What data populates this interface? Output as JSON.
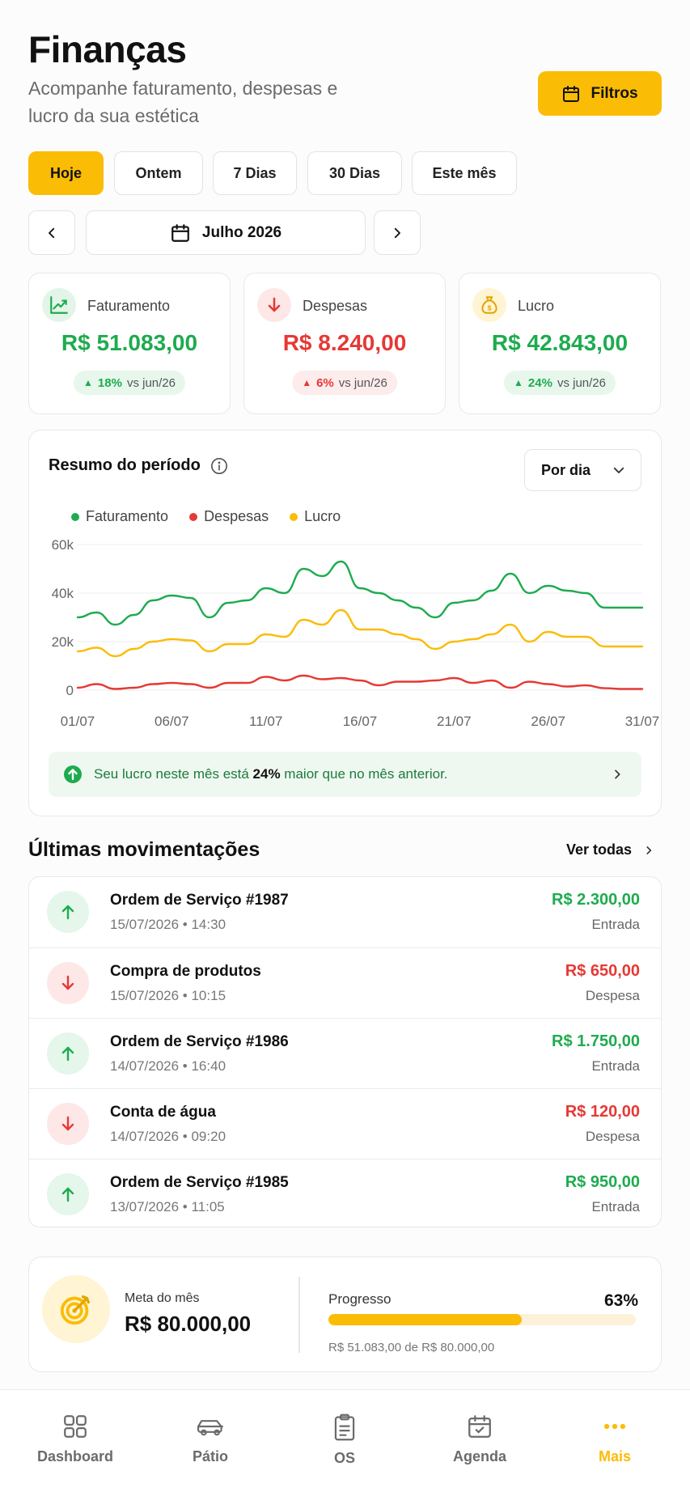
{
  "header": {
    "title": "Finanças",
    "subtitle": "Acompanhe faturamento, despesas e lucro da sua estética",
    "filters_label": "Filtros"
  },
  "periods": [
    "Hoje",
    "Ontem",
    "7 Dias",
    "30 Dias",
    "Este mês"
  ],
  "active_period": "Hoje",
  "month_nav": {
    "label": "Julho 2026"
  },
  "kpis": [
    {
      "label": "Faturamento",
      "value": "R$ 51.083,00",
      "change": "18%",
      "compare": "vs jun/26",
      "color": "#1eab4f"
    },
    {
      "label": "Despesas",
      "value": "R$ 8.240,00",
      "change": "6%",
      "compare": "vs jun/26",
      "color": "#e53935"
    },
    {
      "label": "Lucro",
      "value": "R$ 42.843,00",
      "change": "24%",
      "compare": "vs jun/26",
      "color": "#1eab4f"
    }
  ],
  "summary": {
    "title": "Resumo do período",
    "granularity": "Por dia",
    "insight_prefix": "Seu lucro neste mês está ",
    "insight_bold": "24%",
    "insight_suffix": " maior que no mês anterior."
  },
  "chart_data": {
    "type": "line",
    "x_tick_labels": [
      "01/07",
      "06/07",
      "11/07",
      "16/07",
      "21/07",
      "26/07",
      "31/07"
    ],
    "y_tick_labels": [
      "60k",
      "40k",
      "20k",
      "0"
    ],
    "ylim": [
      0,
      60000
    ],
    "x": [
      "01/07",
      "02/07",
      "03/07",
      "04/07",
      "05/07",
      "06/07",
      "07/07",
      "08/07",
      "09/07",
      "10/07",
      "11/07",
      "12/07",
      "13/07",
      "14/07",
      "15/07",
      "16/07",
      "17/07",
      "18/07",
      "19/07",
      "20/07",
      "21/07",
      "22/07",
      "23/07",
      "24/07",
      "25/07",
      "26/07",
      "27/07",
      "28/07",
      "29/07",
      "30/07",
      "31/07"
    ],
    "series": [
      {
        "name": "Faturamento",
        "color": "#1eab4f",
        "values": [
          30000,
          32000,
          27000,
          31000,
          37000,
          39000,
          38000,
          30000,
          36000,
          37000,
          42000,
          40000,
          50000,
          47000,
          53000,
          42000,
          40000,
          37000,
          34000,
          30000,
          36000,
          37000,
          41000,
          48000,
          40000,
          43000,
          41000,
          40000,
          34000,
          34000,
          34000
        ]
      },
      {
        "name": "Despesas",
        "color": "#e53935",
        "values": [
          1000,
          2500,
          500,
          1000,
          2500,
          3000,
          2500,
          1000,
          3000,
          3000,
          5500,
          4000,
          6000,
          4500,
          5000,
          4000,
          2000,
          3500,
          3500,
          4000,
          5000,
          3000,
          4000,
          1000,
          3500,
          2500,
          1500,
          2000,
          800,
          500,
          500
        ]
      },
      {
        "name": "Lucro",
        "color": "#fbbc05",
        "values": [
          16000,
          17500,
          14000,
          17000,
          20000,
          21000,
          20500,
          16000,
          19000,
          19000,
          23000,
          22000,
          29000,
          27000,
          33000,
          25000,
          25000,
          23000,
          21000,
          17000,
          20000,
          21000,
          23000,
          27000,
          20000,
          24000,
          22000,
          22000,
          18000,
          18000,
          18000
        ]
      }
    ],
    "legend": "top-left",
    "grid": true
  },
  "movements": {
    "title": "Últimas movimentações",
    "see_all": "Ver todas",
    "items": [
      {
        "name": "Ordem de Serviço #1987",
        "date": "15/07/2026 • 14:30",
        "amount": "R$ 2.300,00",
        "kind": "Entrada",
        "type": "in"
      },
      {
        "name": "Compra de produtos",
        "date": "15/07/2026 • 10:15",
        "amount": "R$ 650,00",
        "kind": "Despesa",
        "type": "out"
      },
      {
        "name": "Ordem de Serviço #1986",
        "date": "14/07/2026 • 16:40",
        "amount": "R$ 1.750,00",
        "kind": "Entrada",
        "type": "in"
      },
      {
        "name": "Conta de água",
        "date": "14/07/2026 • 09:20",
        "amount": "R$ 120,00",
        "kind": "Despesa",
        "type": "out"
      },
      {
        "name": "Ordem de Serviço #1985",
        "date": "13/07/2026 • 11:05",
        "amount": "R$ 950,00",
        "kind": "Entrada",
        "type": "in"
      }
    ]
  },
  "goal": {
    "label": "Meta do mês",
    "value": "R$ 80.000,00",
    "progress_label": "Progresso",
    "progress_pct": "63%",
    "progress_fraction": 0.63,
    "progress_sub": "R$ 51.083,00 de R$ 80.000,00"
  },
  "bottom_nav": [
    {
      "label": "Dashboard",
      "icon": "grid-icon"
    },
    {
      "label": "Pátio",
      "icon": "car-icon"
    },
    {
      "label": "OS",
      "icon": "clipboard-icon"
    },
    {
      "label": "Agenda",
      "icon": "calendar-icon"
    },
    {
      "label": "Mais",
      "icon": "more-icon",
      "active": true
    }
  ],
  "colors": {
    "accent": "#fbbc05",
    "green": "#1eab4f",
    "red": "#e53935"
  }
}
